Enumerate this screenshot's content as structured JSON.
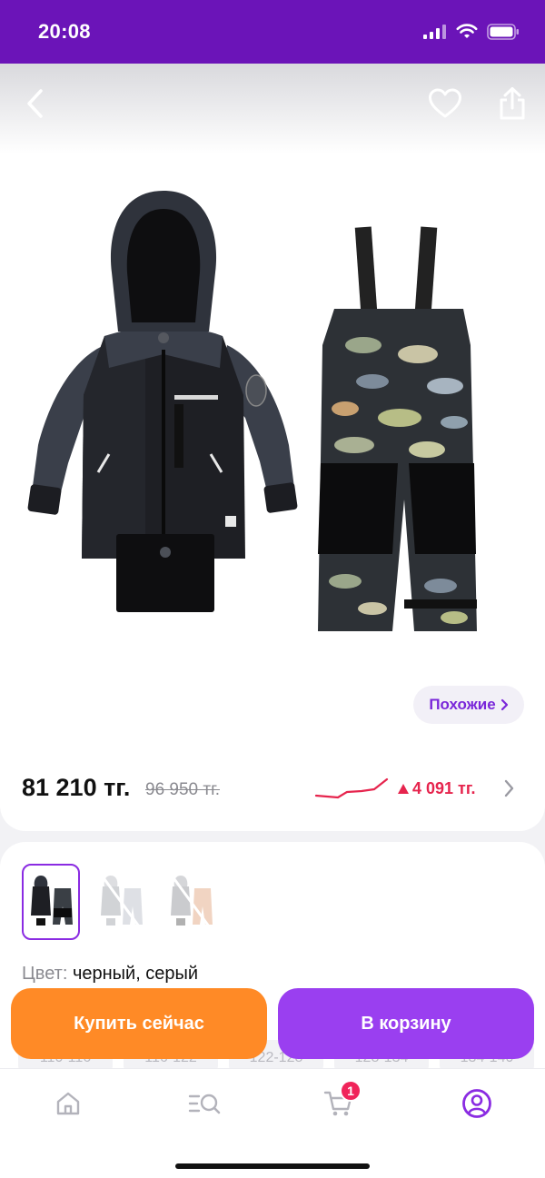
{
  "status_bar": {
    "time": "20:08"
  },
  "header": {
    "back_icon": "chevron-left-icon",
    "favorite_icon": "heart-icon",
    "share_icon": "share-icon"
  },
  "product": {
    "image_description_icon": "product-photo",
    "similar_label": "Похожие",
    "price_current": "81 210 тг.",
    "price_old": "96 950 тг.",
    "price_change": "4 091 тг.",
    "price_change_icon": "triangle-up-icon"
  },
  "options": {
    "thumbnails": [
      "thumbnail-black",
      "thumbnail-gray",
      "thumbnail-beige"
    ],
    "selected_thumbnail": 0,
    "color_label": "Цвет:",
    "color_value": "черный, серый",
    "sizes": [
      "110-116",
      "116-122",
      "122-128",
      "128-134",
      "134-140"
    ]
  },
  "actions": {
    "buy_now_label": "Купить сейчас",
    "add_to_cart_label": "В корзину"
  },
  "tab_bar": {
    "cart_badge": "1",
    "active_tab": "profile"
  },
  "colors": {
    "brand_purple": "#6b14b8",
    "accent_purple": "#9a3ff0",
    "buy_orange": "#ff8a26",
    "price_up_red": "#e6244d"
  }
}
